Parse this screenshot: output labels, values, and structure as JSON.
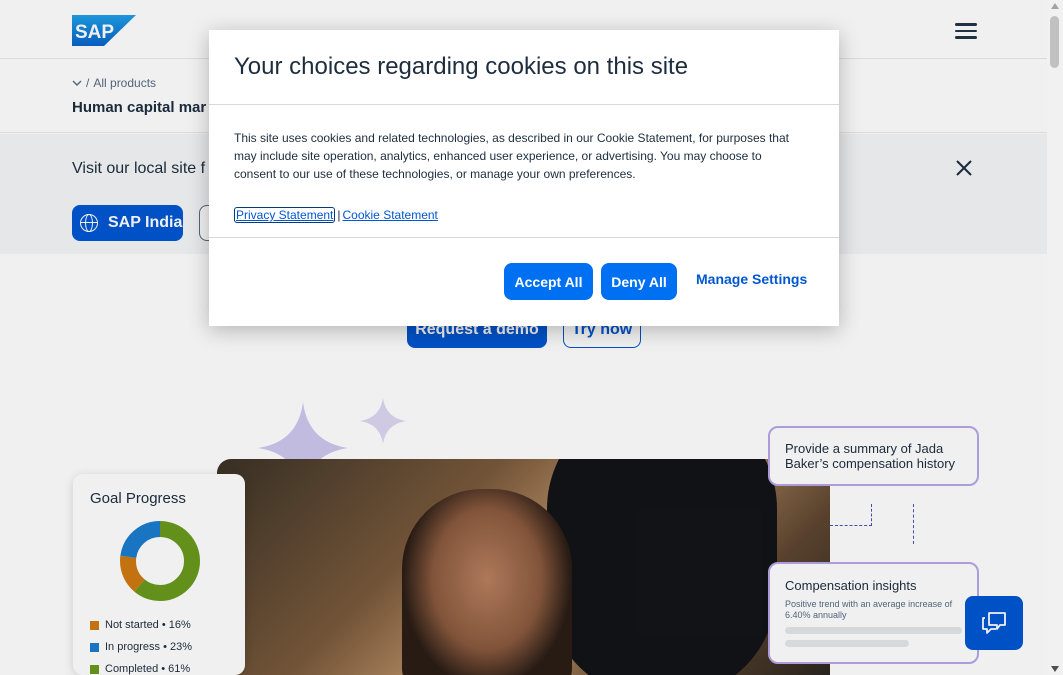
{
  "header": {
    "logo_text": "SAP"
  },
  "breadcrumb": {
    "separator": "/",
    "link": "All products",
    "title": "Human capital mar"
  },
  "local_site": {
    "text": "Visit our local site f",
    "primary_button": "SAP India"
  },
  "cta": {
    "demo": "Request a demo",
    "try": "Try now"
  },
  "goal_card": {
    "title": "Goal Progress",
    "legend": [
      {
        "label": "Not started • 16%",
        "color": "#d07a12",
        "value": 16
      },
      {
        "label": "In progress • 23%",
        "color": "#1b7ccf",
        "value": 23
      },
      {
        "label": "Completed • 61%",
        "color": "#6a9a1d",
        "value": 61
      }
    ]
  },
  "ai": {
    "prompt": "Provide a summary of Jada Baker’s compensation history",
    "insight_title": "Compensation insights",
    "insight_sub": "Positive trend with an average increase of 6.40% annually"
  },
  "cookie_modal": {
    "title": "Your choices regarding cookies on this site",
    "body": "This site uses cookies and related technologies, as described in our Cookie Statement, for purposes that may include site operation, analytics, enhanced user experience, or advertising. You may choose to consent to our use of these technologies, or manage your own preferences.",
    "privacy_link": "Privacy Statement",
    "separator": "|",
    "cookie_link": "Cookie Statement",
    "accept": "Accept All",
    "deny": "Deny All",
    "manage": "Manage Settings"
  },
  "colors": {
    "brand_blue": "#0070f2",
    "link_blue": "#0057d2"
  }
}
